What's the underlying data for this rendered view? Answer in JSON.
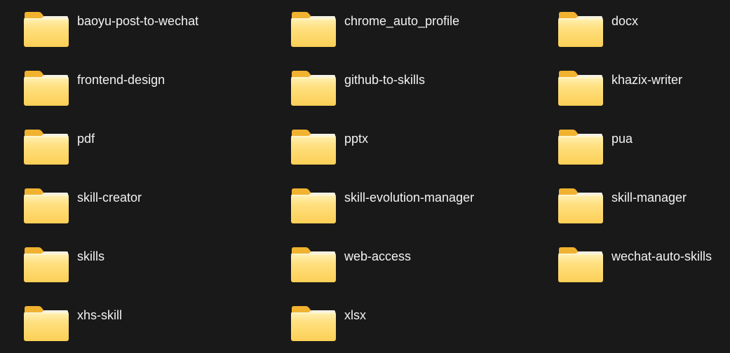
{
  "folders": [
    {
      "name": "baoyu-post-to-wechat"
    },
    {
      "name": "chrome_auto_profile"
    },
    {
      "name": "docx"
    },
    {
      "name": "frontend-design"
    },
    {
      "name": "github-to-skills"
    },
    {
      "name": "khazix-writer"
    },
    {
      "name": "pdf"
    },
    {
      "name": "pptx"
    },
    {
      "name": "pua"
    },
    {
      "name": "skill-creator"
    },
    {
      "name": "skill-evolution-manager"
    },
    {
      "name": "skill-manager"
    },
    {
      "name": "skills"
    },
    {
      "name": "web-access"
    },
    {
      "name": "wechat-auto-skills"
    },
    {
      "name": "xhs-skill"
    },
    {
      "name": "xlsx"
    }
  ],
  "icon": "folder-icon",
  "colors": {
    "background": "#191919",
    "label_text": "#f2f2f2",
    "folder_body_top": "#fff0b3",
    "folder_body_bottom": "#fccf56",
    "folder_back": "#f1b230"
  }
}
